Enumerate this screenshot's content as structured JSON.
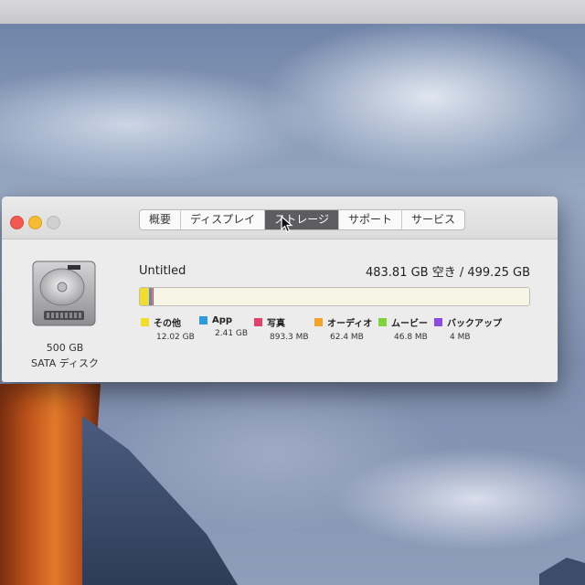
{
  "window": {
    "tabs": [
      {
        "label": "概要"
      },
      {
        "label": "ディスプレイ"
      },
      {
        "label": "ストレージ"
      },
      {
        "label": "サポート"
      },
      {
        "label": "サービス"
      }
    ],
    "active_tab": "ストレージ"
  },
  "disk": {
    "capacity_label": "500 GB",
    "type_label": "SATA ディスク",
    "icon": "hard-drive-icon"
  },
  "volume": {
    "name": "Untitled",
    "free_summary": "483.81 GB 空き / 499.25 GB",
    "total_gb": 499.25,
    "free_gb": 483.81
  },
  "storage": {
    "categories": [
      {
        "name": "その他",
        "size_label": "12.02 GB",
        "gb": 12.02,
        "color": "#f2dd2a"
      },
      {
        "name": "App",
        "size_label": "2.41 GB",
        "gb": 2.41,
        "color": "#2c9be0"
      },
      {
        "name": "写真",
        "size_label": "893.3 MB",
        "gb": 0.8933,
        "color": "#e3416c"
      },
      {
        "name": "オーディオ",
        "size_label": "62.4 MB",
        "gb": 0.0624,
        "color": "#f3a325"
      },
      {
        "name": "ムービー",
        "size_label": "46.8 MB",
        "gb": 0.0468,
        "color": "#7fd43a"
      },
      {
        "name": "バックアップ",
        "size_label": "4 MB",
        "gb": 0.004,
        "color": "#8b4ae0"
      }
    ]
  },
  "colors": {
    "active_tab_bg": "#5d5d5f",
    "free_space_bg": "#f6f5e6"
  }
}
